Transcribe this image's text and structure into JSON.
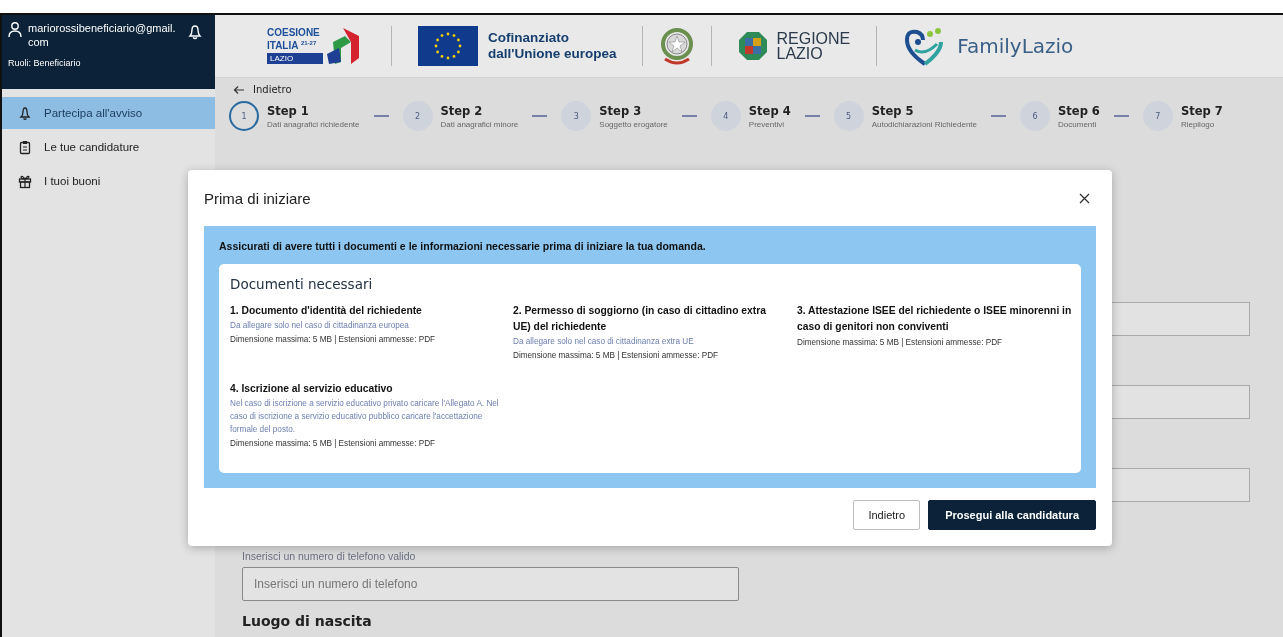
{
  "user": {
    "email": "mariorossibeneficiario@gmail.com",
    "roles": "Ruoli: Beneficiario"
  },
  "sidebar": {
    "items": [
      {
        "label": "Partecipa all'avviso",
        "kind": "bell",
        "selected": true
      },
      {
        "label": "Le tue candidature",
        "kind": "clipboard",
        "selected": false
      },
      {
        "label": "I tuoi buoni",
        "kind": "gift",
        "selected": false
      }
    ]
  },
  "header": {
    "coesione": {
      "line_1": "COESIONE",
      "line_2": "ITALIA $^{21-27}$",
      "band": "LAZIO"
    },
    "eu_text": [
      "Cofinanziato",
      "dall'Unione europea"
    ],
    "regione": [
      "REGIONE",
      "LAZIO"
    ],
    "family": "FamilyLazio"
  },
  "back_link": "Indietro",
  "steps": [
    {
      "number": "1",
      "title": "Step 1",
      "subtitle": "Dati anagrafici richiedente",
      "selected": true
    },
    {
      "number": "2",
      "title": "Step 2",
      "subtitle": "Dati anagrafici minore",
      "selected": false
    },
    {
      "number": "3",
      "title": "Step 3",
      "subtitle": "Soggetto erogatore",
      "selected": false
    },
    {
      "number": "4",
      "title": "Step 4",
      "subtitle": "Preventivi",
      "selected": false
    },
    {
      "number": "5",
      "title": "Step 5",
      "subtitle": "Autodichiarazioni Richiedente",
      "selected": false
    },
    {
      "number": "6",
      "title": "Step 6",
      "subtitle": "Documenti",
      "selected": false
    },
    {
      "number": "7",
      "title": "Step 7",
      "subtitle": "Riepilogo",
      "selected": false
    }
  ],
  "form": {
    "phone_hint": "Inserisci un numero di telefono valido",
    "phone_placeholder": "Inserisci un numero di telefono",
    "next_label": "Luogo di nascita"
  },
  "modal": {
    "title": "Prima di iniziare",
    "intro": "Assicurati di avere tutti i documenti e le informazioni necessarie prima di iniziare la tua domanda.",
    "card_title": "Documenti necessari",
    "documents": [
      {
        "title": "1. Documento d'identità del richiedente",
        "note": "Da allegare solo nel caso di cittadinanza europea",
        "limits": "Dimensione massima: 5 MB | Estensioni ammesse: PDF"
      },
      {
        "title": "2. Permesso di soggiorno (in caso di cittadino extra UE) del richiedente",
        "note": "Da allegare solo nel caso di cittadinanza extra UE",
        "limits": "Dimensione massima: 5 MB | Estensioni ammesse: PDF"
      },
      {
        "title": "3. Attestazione ISEE del richiedente o ISEE minorenni in caso di genitori non conviventi",
        "limits": "Dimensione massima: 5 MB | Estensioni ammesse: PDF"
      },
      {
        "title": "4. Iscrizione al servizio educativo",
        "note": "Nel caso di iscrizione a servizio educativo privato caricare l'Allegato A. Nel caso di iscrizione a servizio educativo pubblico caricare l'accettazione formale del posto.",
        "limits": "Dimensione massima: 5 MB | Estensioni ammesse: PDF"
      }
    ],
    "buttons": [
      {
        "label": "Indietro",
        "kind": "secondary"
      },
      {
        "label": "Prosegui alla candidatura",
        "kind": "primary"
      }
    ]
  }
}
